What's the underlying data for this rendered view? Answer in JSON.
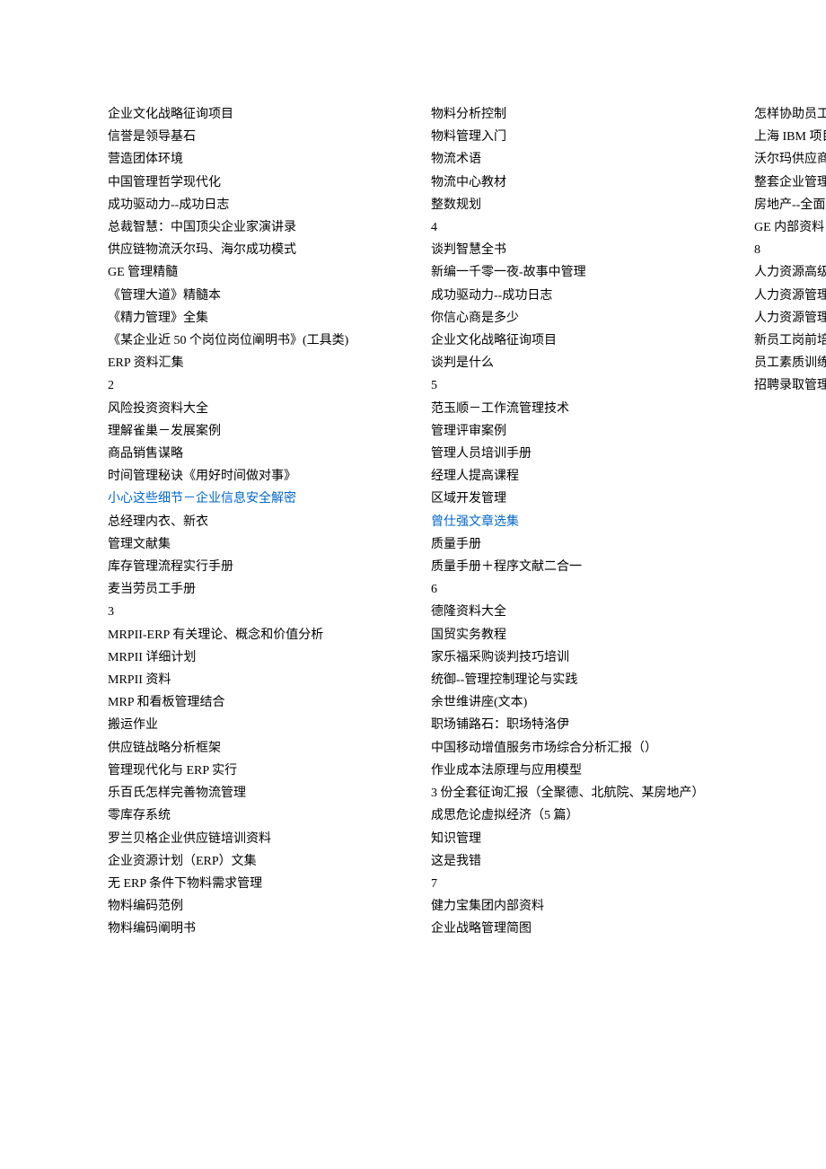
{
  "left": [
    {
      "text": "企业文化战略征询项目"
    },
    {
      "text": "信誉是领导基石"
    },
    {
      "text": "营造团体环境"
    },
    {
      "text": "中国管理哲学现代化"
    },
    {
      "text": "成功驱动力--成功日志"
    },
    {
      "text": "总裁智慧：中国顶尖企业家演讲录"
    },
    {
      "text": "供应链物流沃尔玛、海尔成功模式"
    },
    {
      "text": "GE 管理精髓"
    },
    {
      "text": "《管理大道》精髓本"
    },
    {
      "text": "《精力管理》全集"
    },
    {
      "text": "《某企业近 50 个岗位岗位阐明书》(工具类)"
    },
    {
      "text": "ERP 资料汇集"
    },
    {
      "text": "2"
    },
    {
      "text": "风险投资资料大全"
    },
    {
      "text": "理解雀巢－发展案例"
    },
    {
      "text": "商品销售谋略"
    },
    {
      "text": "时间管理秘诀《用好时间做对事》"
    },
    {
      "text": "小心这些细节－企业信息安全解密",
      "link": true
    },
    {
      "text": "总经理内衣、新衣"
    },
    {
      "text": "管理文献集"
    },
    {
      "text": "库存管理流程实行手册"
    },
    {
      "text": "麦当劳员工手册"
    },
    {
      "text": "3"
    },
    {
      "text": "MRPII-ERP 有关理论、概念和价值分析"
    },
    {
      "text": "MRPII 详细计划"
    },
    {
      "text": "MRPII 资料"
    },
    {
      "text": "MRP 和看板管理结合"
    },
    {
      "text": "搬运作业"
    },
    {
      "text": "供应链战略分析框架"
    },
    {
      "text": "管理现代化与 ERP 实行"
    },
    {
      "text": "乐百氏怎样完善物流管理"
    },
    {
      "text": "零库存系统"
    },
    {
      "text": "罗兰贝格企业供应链培训资料"
    },
    {
      "text": "企业资源计划（ERP）文集"
    },
    {
      "text": "无 ERP 条件下物料需求管理"
    },
    {
      "text": "物料编码范例"
    },
    {
      "text": "物料编码阐明书"
    },
    {
      "text": "物料分析控制"
    },
    {
      "text": "物料管理入门"
    },
    {
      "text": "物流术语"
    },
    {
      "text": "物流中心教材"
    },
    {
      "text": "整数规划"
    },
    {
      "text": "4"
    }
  ],
  "right": [
    {
      "text": "谈判智慧全书"
    },
    {
      "text": "新编一千零一夜-故事中管理"
    },
    {
      "text": "成功驱动力--成功日志"
    },
    {
      "text": "你信心商是多少"
    },
    {
      "text": "企业文化战略征询项目"
    },
    {
      "text": "谈判是什么"
    },
    {
      "text": "5"
    },
    {
      "text": "范玉顺－工作流管理技术"
    },
    {
      "text": "管理评审案例"
    },
    {
      "text": "管理人员培训手册"
    },
    {
      "text": "经理人提高课程"
    },
    {
      "text": "区域开发管理"
    },
    {
      "text": "曾仕强文章选集",
      "link": true
    },
    {
      "text": "质量手册"
    },
    {
      "text": "质量手册＋程序文献二合一"
    },
    {
      "text": "6"
    },
    {
      "text": "德隆资料大全"
    },
    {
      "text": "国贸实务教程"
    },
    {
      "text": "家乐福采购谈判技巧培训"
    },
    {
      "text": "统御--管理控制理论与实践"
    },
    {
      "text": "余世维讲座(文本)"
    },
    {
      "text": "职场铺路石：职场特洛伊"
    },
    {
      "text": "中国移动增值服务市场综合分析汇报（）"
    },
    {
      "text": "作业成本法原理与应用模型"
    },
    {
      "text": "3 份全套征询汇报（全聚德、北航院、某房地产）"
    },
    {
      "text": "成思危论虚拟经济（5 篇）"
    },
    {
      "text": "知识管理"
    },
    {
      "text": "这是我错"
    },
    {
      "text": "7"
    },
    {
      "text": "健力宝集团内部资料"
    },
    {
      "text": "企业战略管理简图"
    },
    {
      "text": "怎样协助员工在工作中有更好体现"
    },
    {
      "text": "上海 IBM 项目经理培训"
    },
    {
      "text": "沃尔玛供应商工厂认证手册"
    },
    {
      "text": "整套企业管理制度"
    },
    {
      "text": "房地产--全面信息化处理方案"
    },
    {
      "text": "GE 内部资料"
    },
    {
      "text": "8"
    },
    {
      "text": "人力资源高级研修班详细讲义"
    },
    {
      "text": "人力资源管理教程"
    },
    {
      "text": "人力资源管理制度表格全套样本"
    },
    {
      "text": "新员工岗前培训管理措施"
    },
    {
      "text": "员工素质训练"
    },
    {
      "text": "招聘录取管理措施"
    }
  ]
}
